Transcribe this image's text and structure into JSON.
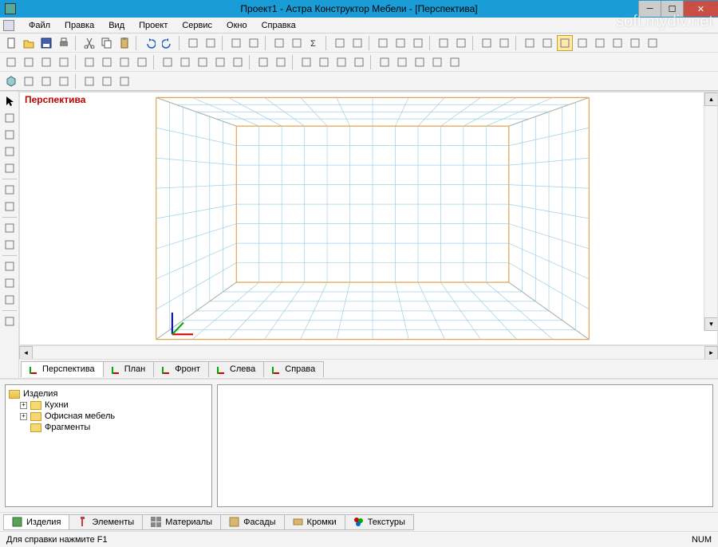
{
  "title": "Проект1 - Астра Конструктор Мебели - [Перспектива]",
  "watermark": "soft.mydiv.net",
  "menu": [
    "Файл",
    "Правка",
    "Вид",
    "Проект",
    "Сервис",
    "Окно",
    "Справка"
  ],
  "viewport": {
    "label": "Перспектива"
  },
  "view_tabs": [
    "Перспектива",
    "План",
    "Фронт",
    "Слева",
    "Справа"
  ],
  "tree": {
    "root": "Изделия",
    "children": [
      {
        "label": "Кухни",
        "expandable": true
      },
      {
        "label": "Офисная мебель",
        "expandable": true
      },
      {
        "label": "Фрагменты",
        "expandable": false
      }
    ]
  },
  "bottom_tabs": [
    "Изделия",
    "Элементы",
    "Материалы",
    "Фасады",
    "Кромки",
    "Текстуры"
  ],
  "status": {
    "help": "Для справки нажмите F1",
    "num": "NUM"
  },
  "toolbar1_icons": [
    "new-file",
    "open-file",
    "save",
    "print",
    "sep",
    "cut",
    "copy",
    "paste",
    "sep",
    "undo",
    "redo",
    "sep",
    "pointer",
    "hand",
    "sep",
    "flag-red",
    "flag-blue",
    "sep",
    "properties",
    "table",
    "sigma",
    "sep",
    "layers",
    "group",
    "sep",
    "orbit",
    "zoom-in",
    "zoom-fit",
    "sep",
    "axes",
    "align",
    "sep",
    "window",
    "cascade",
    "sep",
    "box1",
    "box2",
    "toggle",
    "box-net",
    "export",
    "material",
    "settings",
    "view3d"
  ],
  "toolbar2_icons": [
    "align-top",
    "align-bottom",
    "align-left",
    "align-right",
    "sep",
    "flip-h",
    "flip-v",
    "rotate-l",
    "rotate-r",
    "sep",
    "panel-1",
    "panel-2",
    "divider",
    "panel-3",
    "shelf",
    "sep",
    "drill",
    "drill-v",
    "sep",
    "dim-h",
    "conn-1",
    "conn-2",
    "conn-3",
    "sep",
    "arrange-1",
    "arrange-2",
    "arrange-3",
    "arrange-4",
    "select-all"
  ],
  "toolbar3_icons": [
    "cube",
    "cube-wire",
    "cylinder",
    "sphere",
    "sep",
    "grid-xy",
    "curve",
    "axis-z"
  ],
  "left_icons": [
    "cursor",
    "pencil",
    "rect",
    "line",
    "cut-tool",
    "sep",
    "ruler",
    "measure",
    "sep",
    "rotate-cw",
    "rotate-ccw",
    "sep",
    "grid",
    "extend",
    "offset",
    "sep",
    "callout"
  ]
}
